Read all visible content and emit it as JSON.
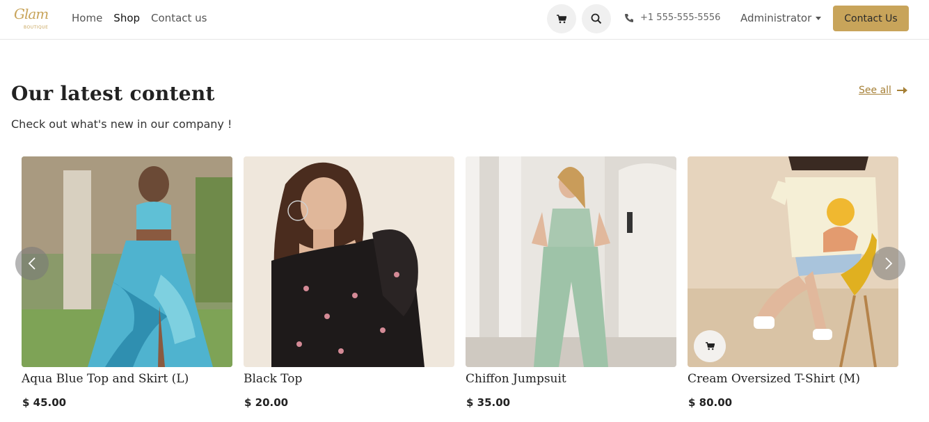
{
  "brand": {
    "logo_script": "Glam",
    "logo_sub": "BOUTIQUE",
    "accent": "#c8a45a"
  },
  "nav": [
    {
      "label": "Home",
      "active": false
    },
    {
      "label": "Shop",
      "active": true
    },
    {
      "label": "Contact us",
      "active": false
    }
  ],
  "header": {
    "phone": "+1 555-555-5556",
    "user": "Administrator",
    "cta_label": "Contact Us",
    "icons": [
      "cart-icon",
      "search-icon",
      "phone-icon"
    ]
  },
  "section": {
    "title": "Our latest content",
    "subtitle": "Check out what's new in our company !",
    "see_all": "See all"
  },
  "products": [
    {
      "name": "Aqua Blue Top and Skirt (L)",
      "price": "$ 45.00"
    },
    {
      "name": "Black Top",
      "price": "$ 20.00"
    },
    {
      "name": "Chiffon Jumpsuit",
      "price": "$ 35.00"
    },
    {
      "name": "Cream Oversized T-Shirt (M)",
      "price": "$ 80.00"
    }
  ]
}
